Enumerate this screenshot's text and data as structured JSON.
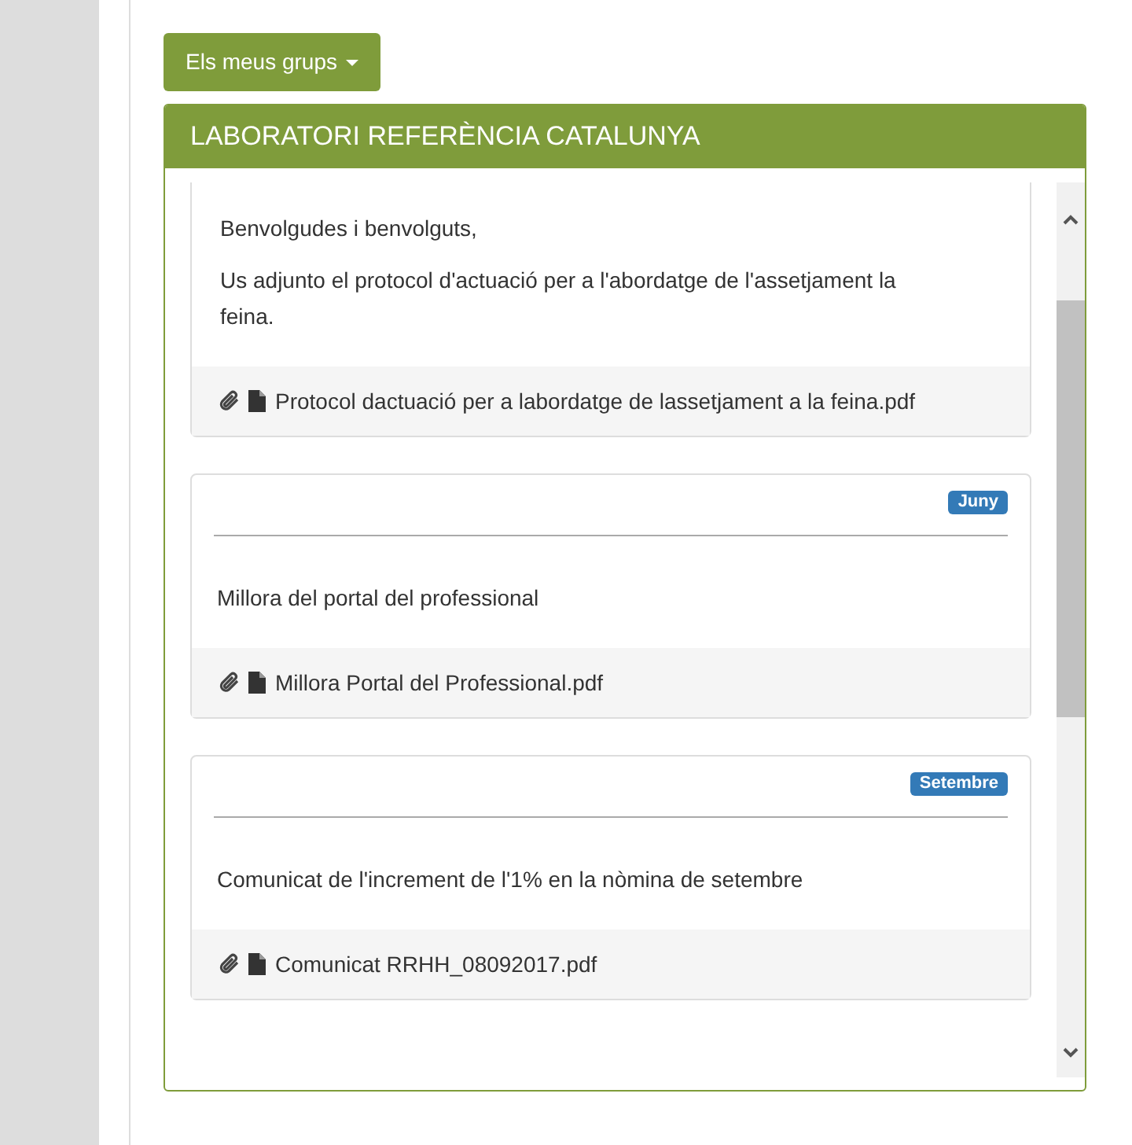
{
  "groups_button": {
    "label": "Els meus grups"
  },
  "panel": {
    "title": "LABORATORI REFERÈNCIA CATALUNYA"
  },
  "posts": [
    {
      "paragraphs": [
        "Benvolgudes i benvolguts,",
        "Us adjunto el protocol d'actuació per a l'abordatge de l'assetjament  la feina."
      ],
      "attachment": "Protocol dactuació per a labordatge de lassetjament a la feina.pdf"
    },
    {
      "badge": "Juny",
      "paragraphs": [
        "Millora del portal del professional"
      ],
      "attachment": "Millora Portal del Professional.pdf"
    },
    {
      "badge": "Setembre",
      "paragraphs": [
        "Comunicat de l'increment de l'1% en la nòmina de setembre"
      ],
      "attachment": "Comunicat RRHH_08092017.pdf"
    }
  ]
}
